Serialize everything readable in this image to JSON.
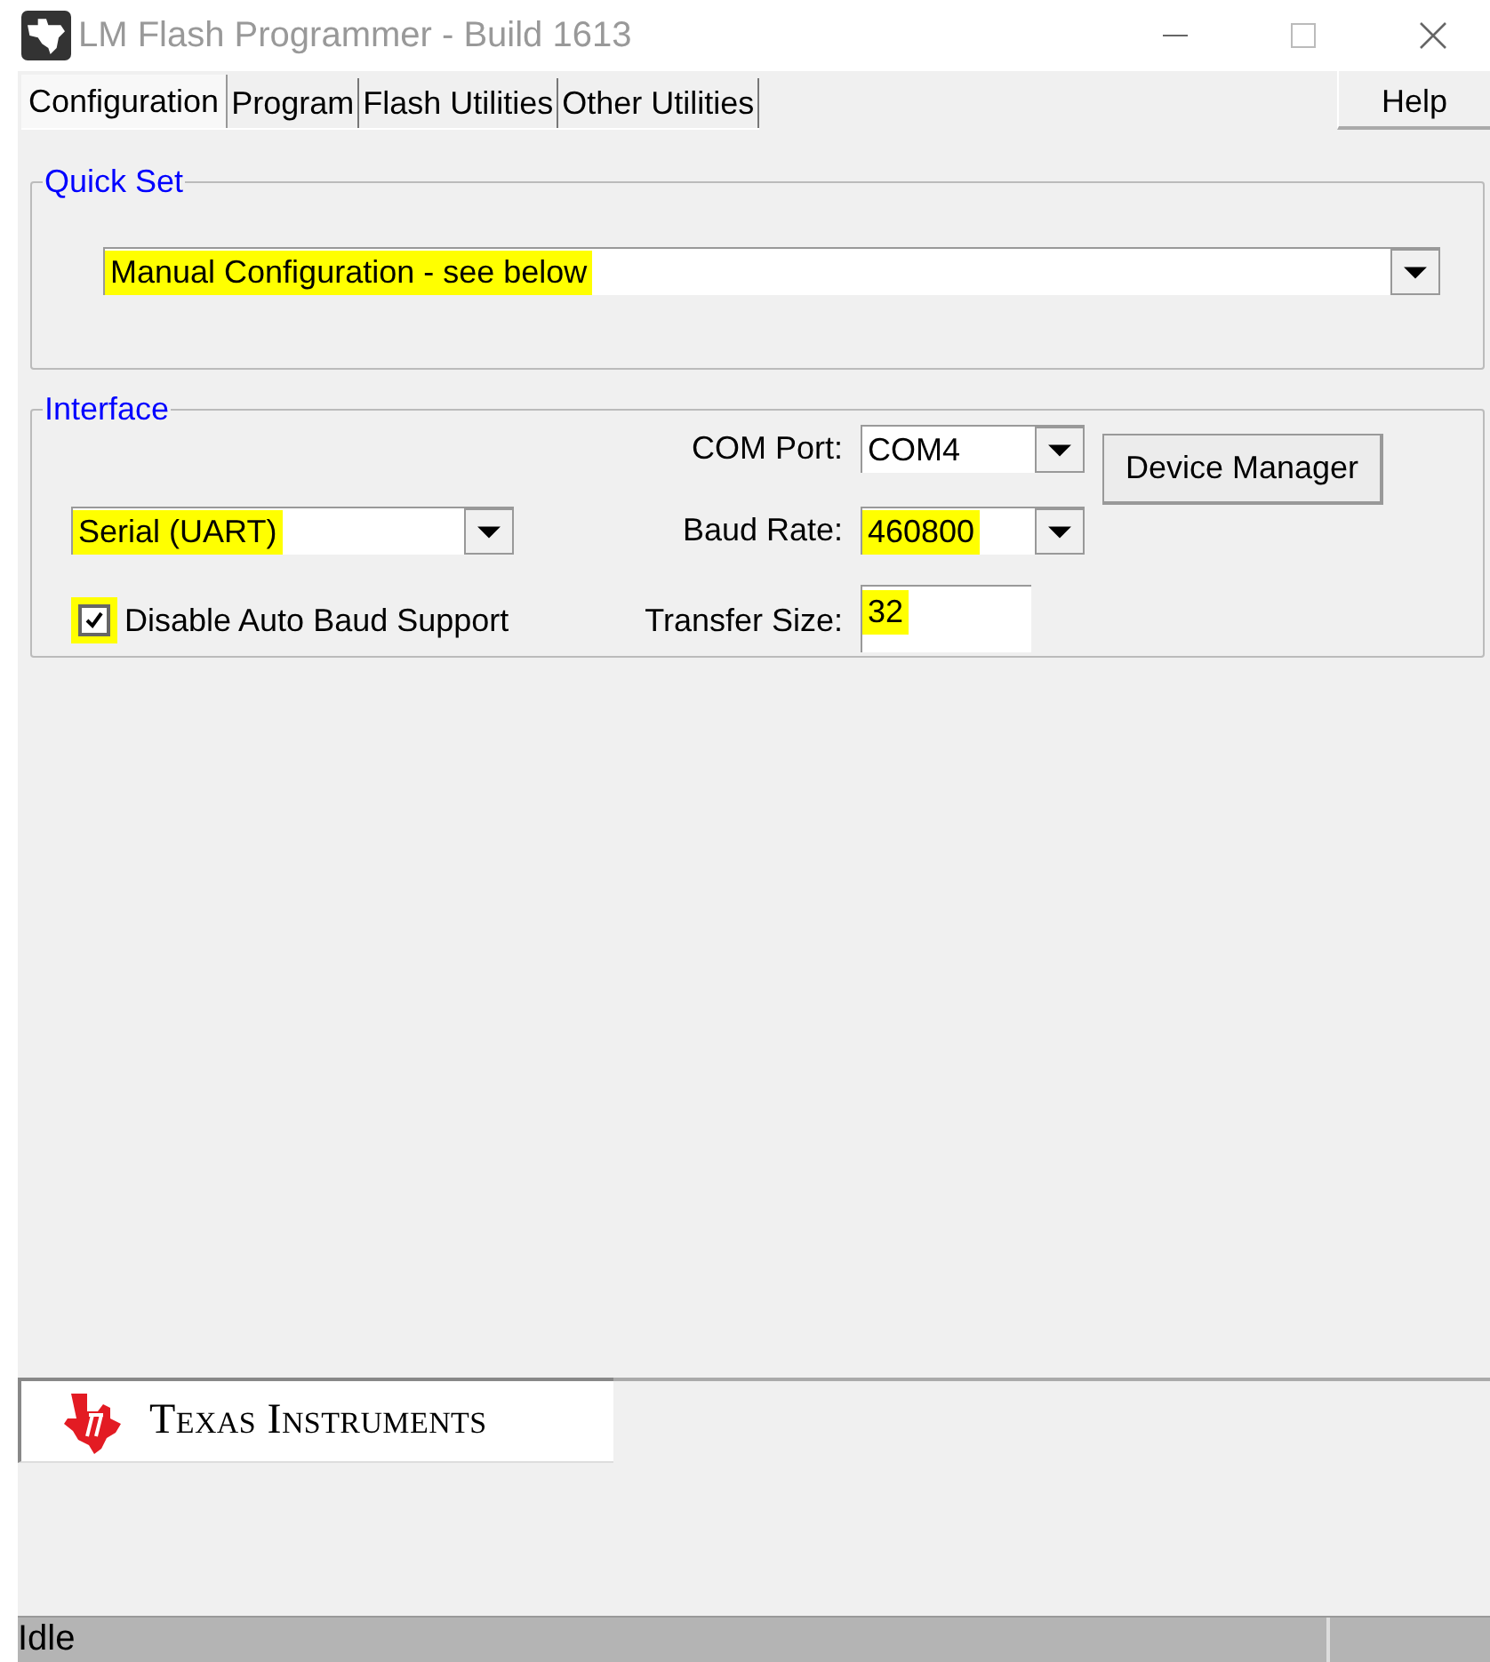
{
  "window": {
    "title": "LM Flash Programmer - Build 1613"
  },
  "tabs": [
    {
      "label": "Configuration",
      "selected": true
    },
    {
      "label": "Program",
      "selected": false
    },
    {
      "label": "Flash Utilities",
      "selected": false
    },
    {
      "label": "Other Utilities",
      "selected": false
    }
  ],
  "help_button": "Help",
  "quick_set": {
    "title": "Quick Set",
    "value": "Manual Configuration - see below",
    "highlighted": true
  },
  "interface": {
    "title": "Interface",
    "type": {
      "value": "Serial (UART)",
      "highlighted": true
    },
    "disable_auto_baud": {
      "label": "Disable Auto Baud Support",
      "checked": true,
      "highlighted": true
    },
    "com_port": {
      "label": "COM Port:",
      "value": "COM4",
      "highlighted": false
    },
    "baud_rate": {
      "label": "Baud Rate:",
      "value": "460800",
      "highlighted": true
    },
    "transfer_size": {
      "label": "Transfer Size:",
      "value": "32",
      "highlighted": true
    },
    "device_manager_button": "Device Manager"
  },
  "logo": {
    "text": "Texas Instruments"
  },
  "status_bar": {
    "text": "Idle"
  }
}
